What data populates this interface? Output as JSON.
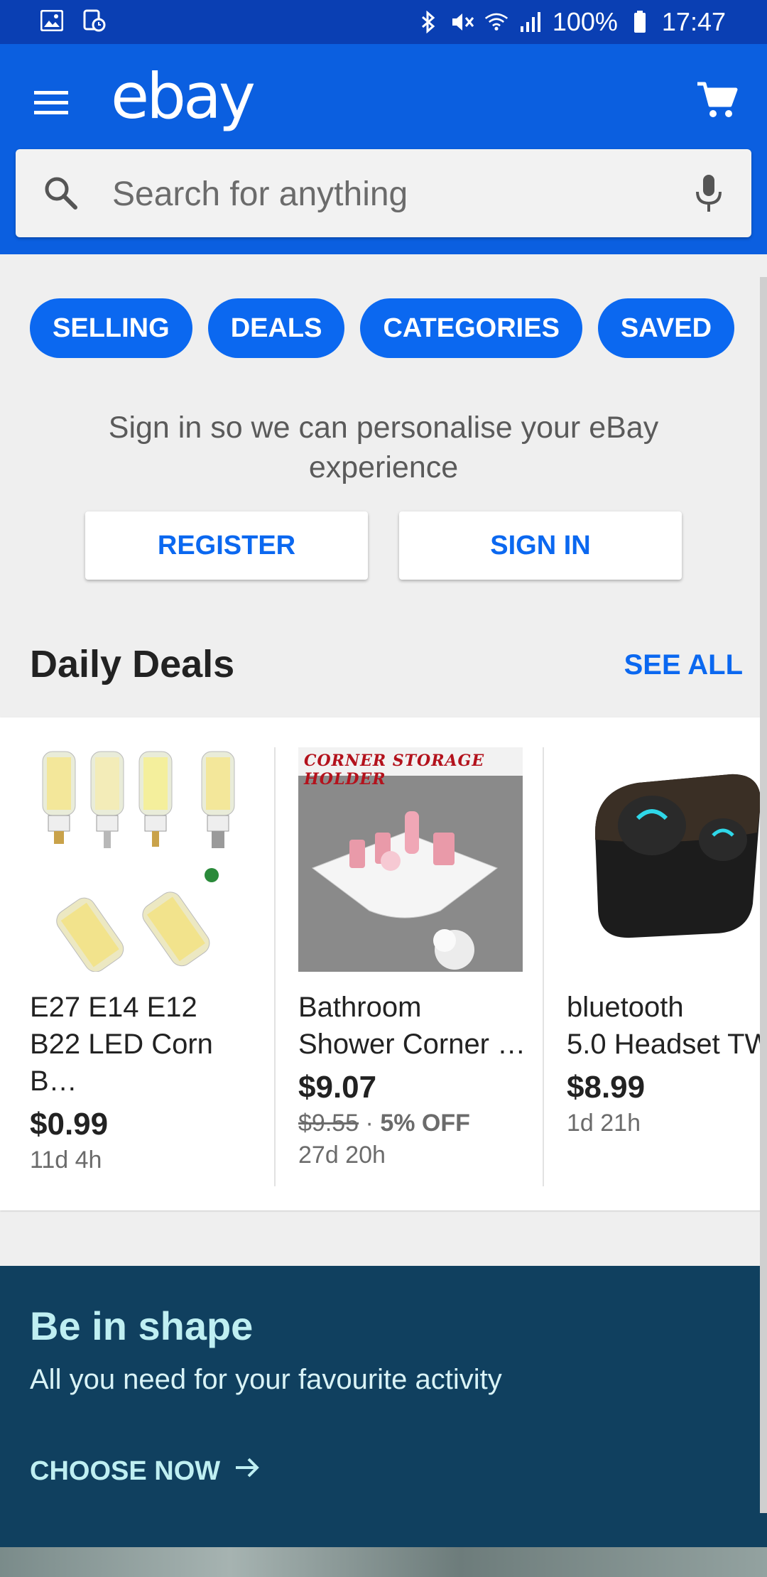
{
  "status_bar": {
    "battery": "100%",
    "time": "17:47"
  },
  "app": {
    "logo": "ebay"
  },
  "search": {
    "placeholder": "Search for anything"
  },
  "pills": [
    {
      "label": "SELLING"
    },
    {
      "label": "DEALS"
    },
    {
      "label": "CATEGORIES"
    },
    {
      "label": "SAVED"
    }
  ],
  "signin_prompt": {
    "text": "Sign in so we can personalise your eBay experience",
    "register_label": "REGISTER",
    "signin_label": "SIGN IN"
  },
  "daily_deals": {
    "title": "Daily Deals",
    "see_all": "SEE ALL",
    "items": [
      {
        "title": "E27 E14 E12\nB22 LED Corn B…",
        "price": "$0.99",
        "time_left": "11d 4h"
      },
      {
        "title": "Bathroom\nShower Corner …",
        "price": "$9.07",
        "original_price": "$9.55",
        "discount": "5% OFF",
        "time_left": "27d 20h",
        "image_caption": "CORNER STORAGE HOLDER"
      },
      {
        "title": "bluetooth\n5.0 Headset TW",
        "price": "$8.99",
        "time_left": "1d 21h"
      }
    ]
  },
  "banner": {
    "title": "Be in shape",
    "subtitle": "All you need for your favourite activity",
    "cta": "CHOOSE NOW"
  },
  "colors": {
    "brand_blue": "#0b5fe0",
    "accent_blue": "#0b68f0",
    "banner_bg": "#10405f"
  }
}
